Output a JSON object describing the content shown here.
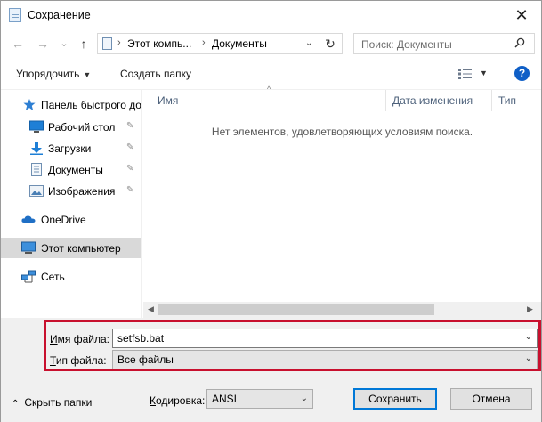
{
  "window": {
    "title": "Сохранение",
    "close_glyph": "✕"
  },
  "nav": {
    "back_glyph": "←",
    "forward_glyph": "→",
    "recent_glyph": "⌄",
    "up_glyph": "↑",
    "address": {
      "segment1": "Этот компь...",
      "separator": "›",
      "segment2": "Документы",
      "chevron": "⌄"
    },
    "refresh_glyph": "↻",
    "search_placeholder": "Поиск: Документы"
  },
  "toolbar": {
    "organize": "Упорядочить",
    "new_folder": "Создать папку",
    "caret": "▼",
    "help": "?"
  },
  "sidebar": {
    "quick_access": "Панель быстрого до",
    "items": [
      {
        "label": "Рабочий стол",
        "icon": "desktop-icon",
        "pinned": true
      },
      {
        "label": "Загрузки",
        "icon": "downloads-icon",
        "pinned": true
      },
      {
        "label": "Документы",
        "icon": "documents-icon",
        "pinned": true
      },
      {
        "label": "Изображения",
        "icon": "pictures-icon",
        "pinned": true
      }
    ],
    "onedrive": "OneDrive",
    "this_pc": "Этот компьютер",
    "network": "Сеть",
    "pin_glyph": "📌"
  },
  "filelist": {
    "columns": [
      "Имя",
      "Дата изменения",
      "Тип"
    ],
    "sort_glyph": "^",
    "empty_message": "Нет элементов, удовлетворяющих условиям поиска."
  },
  "form": {
    "filename_label_accel": "И",
    "filename_label_rest": "мя файла:",
    "filename_value": "setfsb.bat",
    "filetype_label_accel": "Т",
    "filetype_label_rest": "ип файла:",
    "filetype_value": "Все файлы",
    "hide_folders": "Скрыть папки",
    "encoding_label_accel": "К",
    "encoding_label_rest": "одировка:",
    "encoding_value": "ANSI",
    "save": "Сохранить",
    "cancel": "Отмена"
  },
  "colors": {
    "highlight": "#c8102e",
    "accent": "#0078d7",
    "help_blue": "#0f5fc7"
  }
}
